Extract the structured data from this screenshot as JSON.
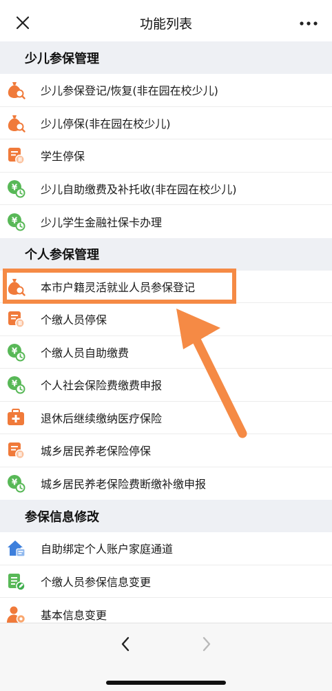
{
  "navbar": {
    "title": "功能列表",
    "close_icon": "close-icon",
    "more_icon": "more-dots-icon"
  },
  "sections": [
    {
      "title": "少儿参保管理",
      "items": [
        {
          "label": "少儿参保登记/恢复(非在园在校少儿)",
          "icon": "moneybag-search-icon"
        },
        {
          "label": "少儿停保(非在园在校少儿)",
          "icon": "moneybag-search-icon"
        },
        {
          "label": "学生停保",
          "icon": "stop-insurance-icon"
        },
        {
          "label": "少儿自助缴费及补托收(非在园在校少儿)",
          "icon": "coin-payment-icon"
        },
        {
          "label": "少儿学生金融社保卡办理",
          "icon": "coin-payment-icon"
        }
      ]
    },
    {
      "title": "个人参保管理",
      "items": [
        {
          "label": "本市户籍灵活就业人员参保登记",
          "icon": "moneybag-search-icon"
        },
        {
          "label": "个缴人员停保",
          "icon": "stop-insurance-icon"
        },
        {
          "label": "个缴人员自助缴费",
          "icon": "coin-payment-icon"
        },
        {
          "label": "个人社会保险费缴费申报",
          "icon": "coin-payment-icon"
        },
        {
          "label": "退休后继续缴纳医疗保险",
          "icon": "medical-kit-icon"
        },
        {
          "label": "城乡居民养老保险停保",
          "icon": "stop-insurance-icon"
        },
        {
          "label": "城乡居民养老保险费断缴补缴申报",
          "icon": "coin-payment-icon"
        }
      ]
    },
    {
      "title": "参保信息修改",
      "items": [
        {
          "label": "自助绑定个人账户家庭通道",
          "icon": "home-bind-icon"
        },
        {
          "label": "个缴人员参保信息变更",
          "icon": "list-edit-icon"
        },
        {
          "label": "基本信息变更",
          "icon": "user-settings-icon"
        }
      ]
    }
  ],
  "bottom_bar": {
    "back_icon": "chevron-left-icon",
    "forward_icon": "chevron-right-icon"
  },
  "colors": {
    "accent_orange": "#f58a45",
    "icon_orange": "#f07a3a",
    "icon_green": "#58b857",
    "icon_blue": "#3d7fdc",
    "section_bg": "#eef0f4"
  }
}
